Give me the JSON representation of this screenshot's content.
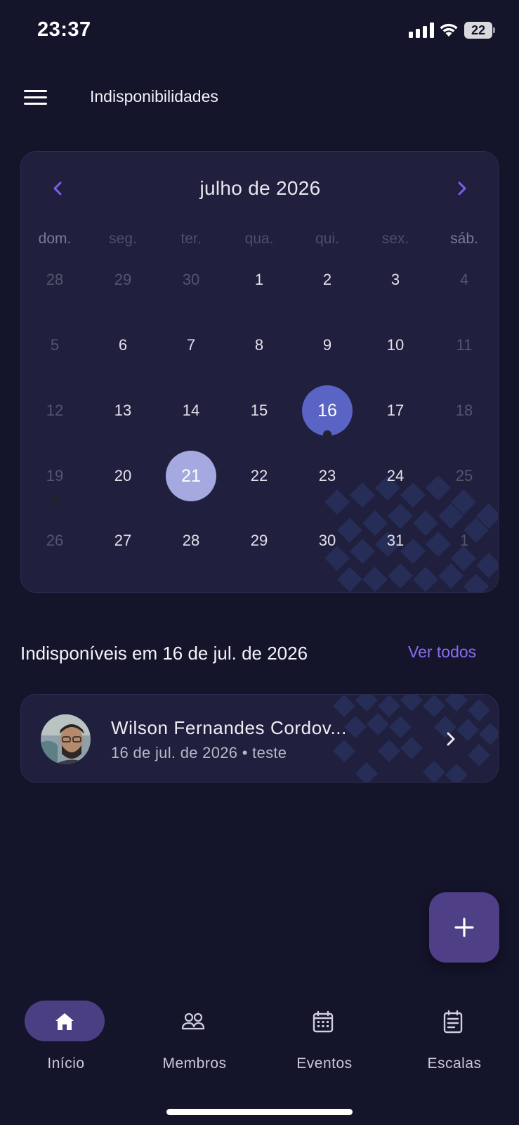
{
  "status_bar": {
    "time": "23:37",
    "battery": "22"
  },
  "app_bar": {
    "title": "Indisponibilidades"
  },
  "calendar": {
    "month_label": "julho de 2026",
    "weekdays": [
      "dom.",
      "seg.",
      "ter.",
      "qua.",
      "qui.",
      "sex.",
      "sáb."
    ],
    "weeks": [
      [
        "28",
        "29",
        "30",
        "1",
        "2",
        "3",
        "4"
      ],
      [
        "5",
        "6",
        "7",
        "8",
        "9",
        "10",
        "11"
      ],
      [
        "12",
        "13",
        "14",
        "15",
        "16",
        "17",
        "18"
      ],
      [
        "19",
        "20",
        "21",
        "22",
        "23",
        "24",
        "25"
      ],
      [
        "26",
        "27",
        "28",
        "29",
        "30",
        "31",
        "1"
      ]
    ],
    "selected_day": "16",
    "highlighted_day": "21",
    "days_with_marker": [
      "16",
      "19"
    ],
    "colors": {
      "selected": "#5a64c4",
      "highlighted": "#a4a9df",
      "accent": "#8a6cf0"
    }
  },
  "section": {
    "title": "Indisponíveis em 16 de jul. de 2026",
    "see_all": "Ver todos"
  },
  "unavailable_list": [
    {
      "name": "Wilson Fernandes Cordov...",
      "subtitle": "16 de jul. de 2026 • teste"
    }
  ],
  "fab": {
    "icon": "plus-icon"
  },
  "bottom_nav": {
    "active": "Início",
    "items": [
      {
        "label": "Início",
        "icon": "home-icon"
      },
      {
        "label": "Membros",
        "icon": "members-icon"
      },
      {
        "label": "Eventos",
        "icon": "calendar-icon"
      },
      {
        "label": "Escalas",
        "icon": "schedule-icon"
      }
    ]
  }
}
